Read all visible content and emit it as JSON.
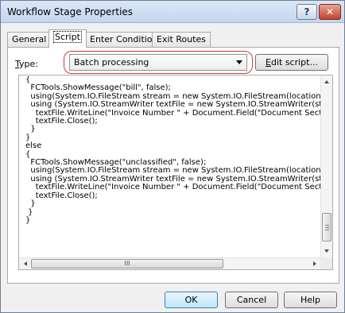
{
  "window": {
    "title": "Workflow Stage Properties"
  },
  "titlebar": {
    "help_glyph": "?",
    "close_glyph": "✕",
    "help_icon": "help-icon",
    "close_icon": "close-icon"
  },
  "tabs": [
    {
      "label": "General",
      "active": false
    },
    {
      "label": "Script",
      "active": true
    },
    {
      "label": "Enter Conditions",
      "active": false
    },
    {
      "label": "Exit Routes",
      "active": false
    }
  ],
  "type": {
    "label_prefix": "T",
    "label_rest": "ype:",
    "selected": "Batch processing"
  },
  "edit_button": {
    "prefix": "E",
    "rest": "dit script..."
  },
  "code": [
    "{",
    "  FCTools.ShowMessage(\"bill\", false);",
    "  using(System.IO.FileStream stream = new System.IO.FileStream(location",
    "  using (System.IO.StreamWriter textFile = new System.IO.StreamWriter(st",
    "    textFile.WriteLine(\"Invoice Number \" + Document.Field(\"Document Secti",
    "    textFile.Close();",
    "  }",
    "}",
    "else",
    "{",
    "  FCTools.ShowMessage(\"unclassified\", false);",
    "  using(System.IO.FileStream stream = new System.IO.FileStream(location",
    "  using (System.IO.StreamWriter textFile = new System.IO.StreamWriter(st",
    "    textFile.WriteLine(\"Invoice Number \" + Document.Field(\"Document Sectic",
    "    textFile.Close();",
    "  }",
    " }",
    "}"
  ],
  "hscroll_grip": "III",
  "buttons": {
    "ok": "OK",
    "cancel": "Cancel",
    "help": "Help"
  },
  "colors": {
    "highlight_ring": "#d43a3a",
    "close_button": "#c1432b",
    "default_button": "#3c7fb1"
  }
}
